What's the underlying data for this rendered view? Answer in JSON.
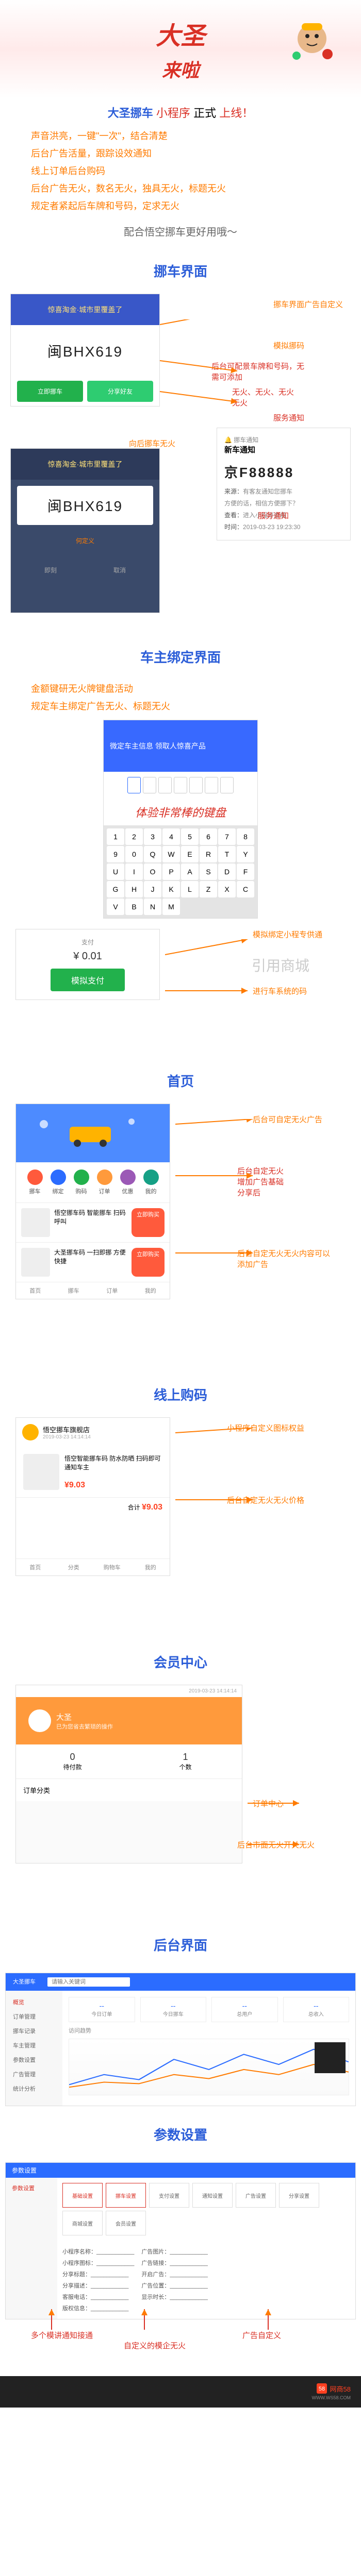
{
  "hero": {
    "big": "大圣",
    "sub": "来啦"
  },
  "title": {
    "brand": "大圣挪车",
    "t1": "小程序",
    "t2": "正式",
    "t3": "上线！"
  },
  "features": [
    "声音洪亮，一键\"一次\"，结合清楚",
    "后台广告活量，跟踪设效通知",
    "线上订单后台购码",
    "后台广告无火，数名无火，独具无火，标题无火",
    "规定者紧起后车牌和号码，定求无火"
  ],
  "slogan": "配合悟空挪车更好用哦～",
  "sec": {
    "s1": "挪车界面",
    "s2": "车主绑定界面",
    "s3": "首页",
    "s4": "线上购码",
    "s5": "会员中心",
    "s6": "后台界面",
    "s7": "参数设置",
    "exp": "体验非常棒的键盘"
  },
  "move": {
    "ad": "惊喜淘金·城市里覆盖了",
    "plate": "闽BHX619",
    "btn1": "立即挪车",
    "btn2": "分享好友",
    "def": "何定义",
    "popup_title": "挪车通知",
    "popup_sub": "新车通知",
    "popup_plate": "京F88888",
    "popup_from": "有客友通知您挪车",
    "popup_hint": "方便的话，相信方便挪下？",
    "popup_via": "进入小程序查看",
    "popup_time": "2019-03-23 19:23:30"
  },
  "notes": {
    "n1": "挪车界面广告自定义",
    "n2": "模拟挪码",
    "n3": "后台可配景车牌和号码，无需可添加",
    "n4": "无火、无火、无火",
    "n4b": "无火",
    "n5": "服务通知",
    "n6": "向后挪车无火",
    "n7": "服务通知",
    "n8": "金额键研无火牌键盘活动",
    "n9": "规定车主绑定广告无火、标题无火",
    "n10": "模拟绑定小程专供通",
    "n11": "进行车系统的码",
    "n12": "后台可自定无火广告",
    "n13": "后台自定无火",
    "n14": "增加广告基础",
    "n15": "分享后",
    "n16": "后台自定无火无火内容可以添加广告",
    "n17": "小程序自定义图标权益",
    "n18": "后台自定无火无火价格",
    "n19": "订单中心",
    "n20": "后台市面无火开关无火",
    "n21": "多个模讲通知接通",
    "n22": "自定义的模企无火",
    "n23": "广告自定义"
  },
  "bind": {
    "banner": "微定车主信息 领取人惊喜产品",
    "kb": [
      "1",
      "2",
      "3",
      "4",
      "5",
      "6",
      "7",
      "8",
      "9",
      "0",
      "Q",
      "W",
      "E",
      "R",
      "T",
      "Y",
      "U",
      "I",
      "O",
      "P",
      "A",
      "S",
      "D",
      "F",
      "G",
      "H",
      "J",
      "K",
      "L",
      "Z",
      "X",
      "C",
      "V",
      "B",
      "N",
      "M"
    ],
    "pay_label": "支付",
    "amount": "¥ 0.01",
    "pay_btn": "模拟支付",
    "mall": "引用商城"
  },
  "home": {
    "icons": [
      "挪车",
      "绑定",
      "购码",
      "订单",
      "优惠",
      "我的"
    ],
    "prod1": "悟空挪车码 智能挪车 扫码呼叫",
    "prod2": "大圣挪车码 一扫即挪 方便快捷",
    "buy": "立即购买",
    "nav": [
      "首页",
      "挪车",
      "订单",
      "我的"
    ]
  },
  "shop": {
    "shop_name": "悟空挪车旗舰店",
    "date": "2019-03-23 14:14:14",
    "prod": "悟空智能挪车码 防水防晒 扫码即可通知车主",
    "price": "¥9.03",
    "total": "合计",
    "nav": [
      "首页",
      "分类",
      "购物车",
      "我的"
    ]
  },
  "member": {
    "name": "大圣",
    "hint": "已为您省去繁琐的操作",
    "stat1_n": "0",
    "stat1_l": "待付款",
    "stat2_n": "1",
    "stat2_l": "个数",
    "orders": "订单分类"
  },
  "admin": {
    "title": "大圣挪车",
    "menu": [
      "概览",
      "订单管理",
      "挪车记录",
      "车主管理",
      "参数设置",
      "广告管理",
      "统计分析"
    ],
    "search": "请输入关键词",
    "stats": [
      "今日订单",
      "今日挪车",
      "总用户",
      "总收入"
    ],
    "chart_l": "访问趋势"
  },
  "params": {
    "tab": "参数设置",
    "modules": [
      "基础设置",
      "挪车设置",
      "支付设置",
      "通知设置",
      "广告设置",
      "分享设置",
      "商城设置",
      "会员设置"
    ],
    "fields_l": [
      "小程序名称",
      "小程序图标",
      "分享标题",
      "分享描述",
      "客服电话",
      "版权信息"
    ],
    "fields_r": [
      "广告图片",
      "广告链接",
      "开启广告",
      "广告位置",
      "显示时长"
    ]
  },
  "footer": "网商58",
  "footer_url": "WWW.WS58.COM"
}
